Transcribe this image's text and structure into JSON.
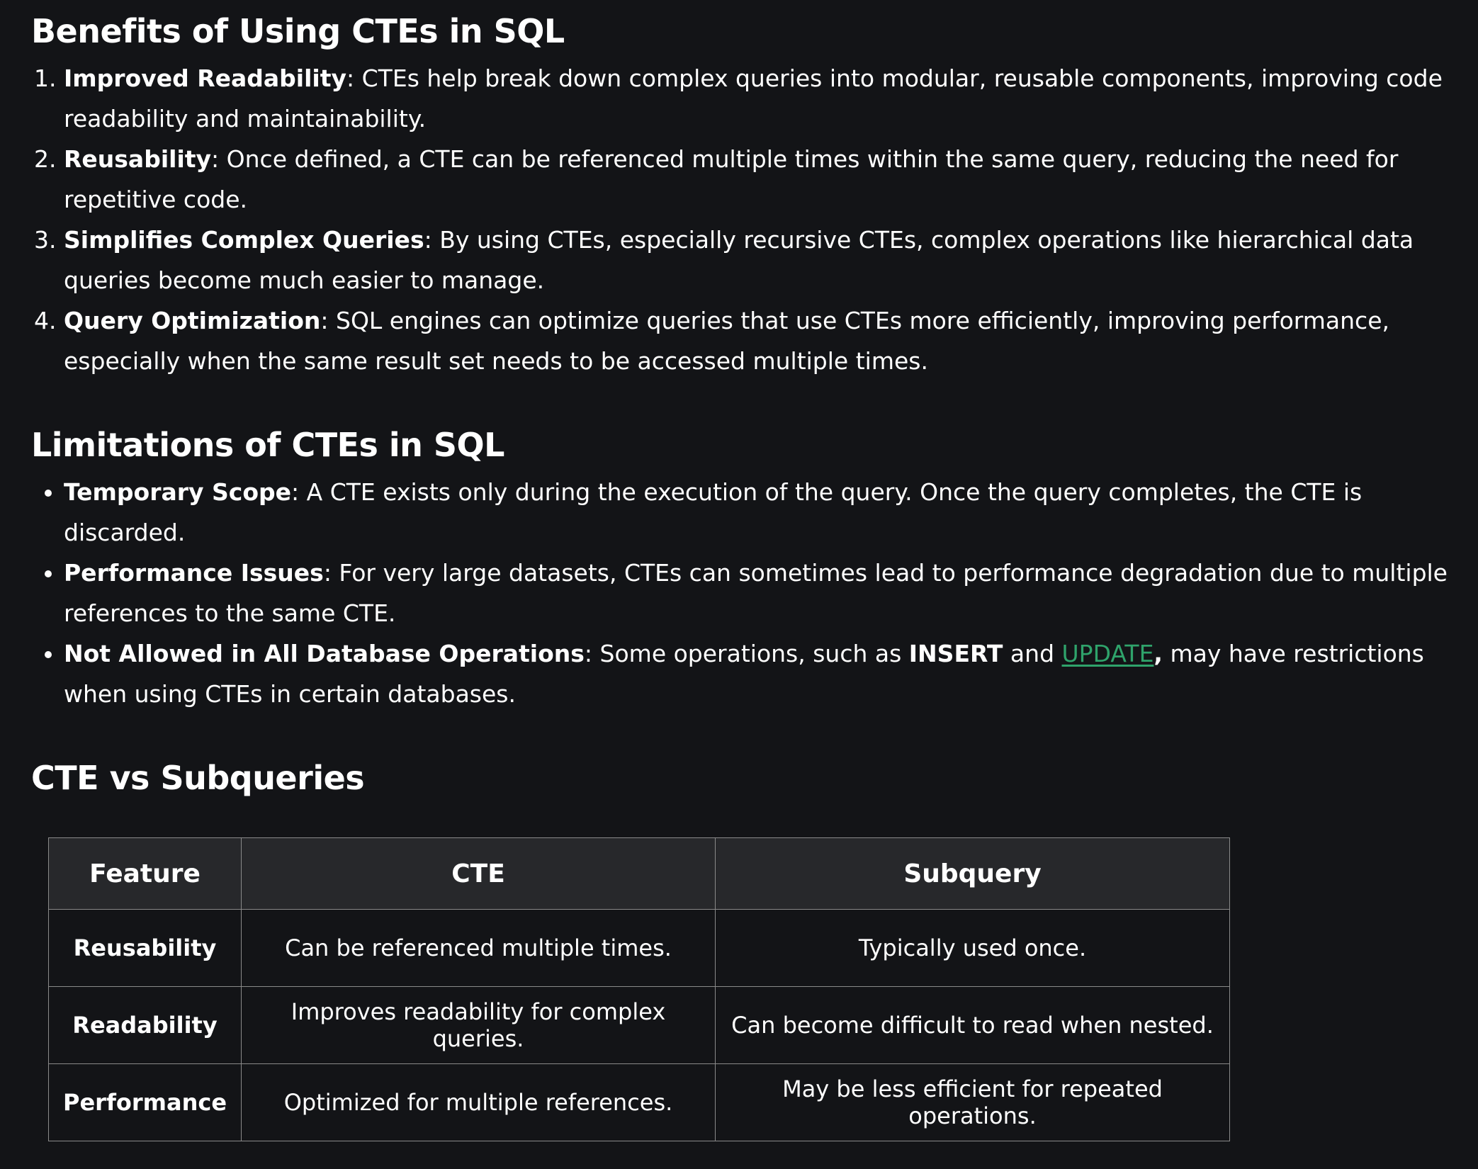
{
  "benefits": {
    "title": "Benefits of Using CTEs in SQL",
    "items": [
      {
        "term": "Improved Readability",
        "text": ": CTEs help break down complex queries into modular, reusable components, improving code readability and maintainability."
      },
      {
        "term": "Reusability",
        "text": ": Once defined, a CTE can be referenced multiple times within the same query, reducing the need for repetitive code."
      },
      {
        "term": "Simplifies Complex Queries",
        "text": ": By using CTEs, especially recursive CTEs, complex operations like hierarchical data queries become much easier to manage."
      },
      {
        "term": "Query Optimization",
        "text": ": SQL engines can optimize queries that use CTEs more efficiently, improving performance, especially when the same result set needs to be accessed multiple times."
      }
    ]
  },
  "limitations": {
    "title": "Limitations of CTEs in SQL",
    "items": [
      {
        "term": "Temporary Scope",
        "text": ": A CTE exists only during the execution of the query. Once the query completes, the CTE is discarded."
      },
      {
        "term": "Performance Issues",
        "text": ": For very large datasets, CTEs can sometimes lead to performance degradation due to multiple references to the same CTE."
      }
    ],
    "last_item": {
      "term": "Not Allowed in All Database Operations",
      "text_before": ": Some operations, such as ",
      "insert": "INSERT",
      "text_and": " and ",
      "update_link": "UPDATE",
      "comma": ",",
      "text_after": " may have restrictions when using CTEs in certain databases."
    }
  },
  "comparison": {
    "title": "CTE vs Subqueries",
    "headers": [
      "Feature",
      "CTE",
      "Subquery"
    ],
    "rows": [
      [
        "Reusability",
        "Can be referenced multiple times.",
        "Typically used once."
      ],
      [
        "Readability",
        "Improves readability for complex queries.",
        "Can become difficult to read when nested."
      ],
      [
        "Performance",
        "Optimized for multiple references.",
        "May be less efficient for repeated operations."
      ]
    ]
  },
  "colors": {
    "background": "#131417",
    "text": "#ffffff",
    "link": "#2fa36b",
    "table_header_bg": "#27282b",
    "table_border": "#8a8a8a"
  }
}
